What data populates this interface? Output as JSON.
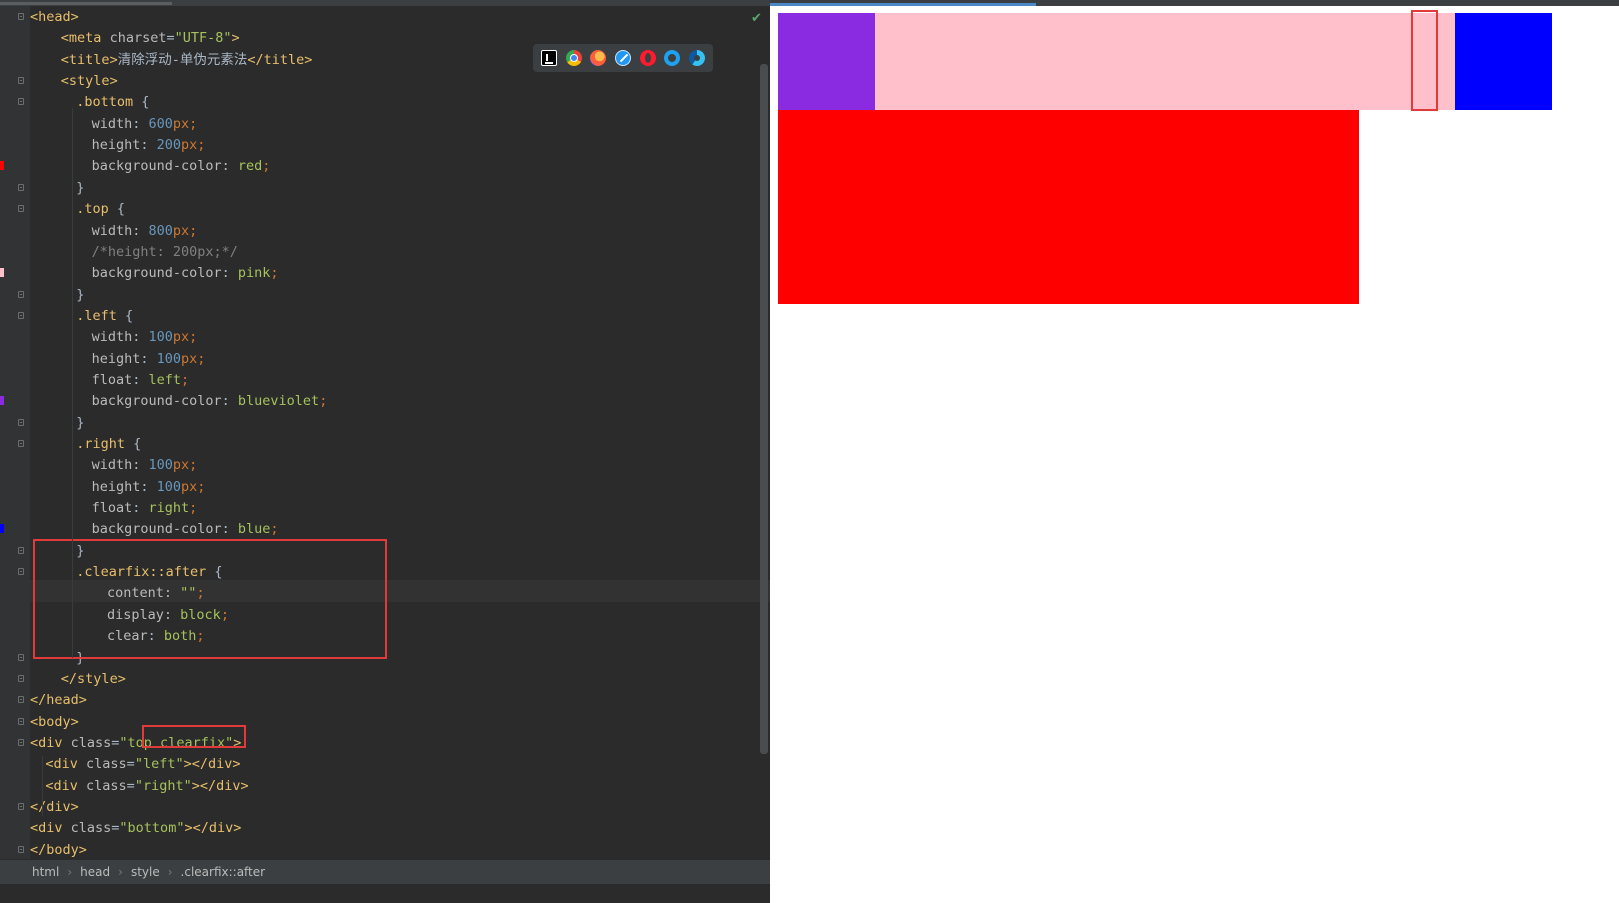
{
  "editor": {
    "lines": [
      {
        "indent": 0,
        "parts": [
          [
            "tag",
            "<head>"
          ]
        ]
      },
      {
        "indent": 4,
        "parts": [
          [
            "tag",
            "<meta "
          ],
          [
            "attr",
            "charset"
          ],
          [
            "txt",
            "="
          ],
          [
            "str",
            "\"UTF-8\""
          ],
          [
            "tag",
            ">"
          ]
        ]
      },
      {
        "indent": 4,
        "parts": [
          [
            "tag",
            "<title>"
          ],
          [
            "txt",
            "清除浮动-单伪元素法"
          ],
          [
            "tag",
            "</title>"
          ]
        ]
      },
      {
        "indent": 4,
        "parts": [
          [
            "tag",
            "<style>"
          ]
        ]
      },
      {
        "indent": 6,
        "parts": [
          [
            "sel",
            ".bottom"
          ],
          [
            "txt",
            " {"
          ]
        ]
      },
      {
        "indent": 8,
        "parts": [
          [
            "prop",
            "width"
          ],
          [
            "txt",
            ": "
          ],
          [
            "num",
            "600"
          ],
          [
            "unit",
            "px"
          ],
          [
            "punc",
            ";"
          ]
        ]
      },
      {
        "indent": 8,
        "parts": [
          [
            "prop",
            "height"
          ],
          [
            "txt",
            ": "
          ],
          [
            "num",
            "200"
          ],
          [
            "unit",
            "px"
          ],
          [
            "punc",
            ";"
          ]
        ]
      },
      {
        "indent": 8,
        "parts": [
          [
            "prop",
            "background-color"
          ],
          [
            "txt",
            ": "
          ],
          [
            "kw",
            "red"
          ],
          [
            "punc",
            ";"
          ]
        ]
      },
      {
        "indent": 6,
        "parts": [
          [
            "txt",
            "}"
          ]
        ]
      },
      {
        "indent": 6,
        "parts": [
          [
            "sel",
            ".top"
          ],
          [
            "txt",
            " {"
          ]
        ]
      },
      {
        "indent": 8,
        "parts": [
          [
            "prop",
            "width"
          ],
          [
            "txt",
            ": "
          ],
          [
            "num",
            "800"
          ],
          [
            "unit",
            "px"
          ],
          [
            "punc",
            ";"
          ]
        ]
      },
      {
        "indent": 8,
        "parts": [
          [
            "cmt",
            "/*height: 200px;*/"
          ]
        ]
      },
      {
        "indent": 8,
        "parts": [
          [
            "prop",
            "background-color"
          ],
          [
            "txt",
            ": "
          ],
          [
            "kw",
            "pink"
          ],
          [
            "punc",
            ";"
          ]
        ]
      },
      {
        "indent": 6,
        "parts": [
          [
            "txt",
            "}"
          ]
        ]
      },
      {
        "indent": 6,
        "parts": [
          [
            "sel",
            ".left"
          ],
          [
            "txt",
            " {"
          ]
        ]
      },
      {
        "indent": 8,
        "parts": [
          [
            "prop",
            "width"
          ],
          [
            "txt",
            ": "
          ],
          [
            "num",
            "100"
          ],
          [
            "unit",
            "px"
          ],
          [
            "punc",
            ";"
          ]
        ]
      },
      {
        "indent": 8,
        "parts": [
          [
            "prop",
            "height"
          ],
          [
            "txt",
            ": "
          ],
          [
            "num",
            "100"
          ],
          [
            "unit",
            "px"
          ],
          [
            "punc",
            ";"
          ]
        ]
      },
      {
        "indent": 8,
        "parts": [
          [
            "prop",
            "float"
          ],
          [
            "txt",
            ": "
          ],
          [
            "kw",
            "left"
          ],
          [
            "punc",
            ";"
          ]
        ]
      },
      {
        "indent": 8,
        "parts": [
          [
            "prop",
            "background-color"
          ],
          [
            "txt",
            ": "
          ],
          [
            "kw",
            "blueviolet"
          ],
          [
            "punc",
            ";"
          ]
        ]
      },
      {
        "indent": 6,
        "parts": [
          [
            "txt",
            "}"
          ]
        ]
      },
      {
        "indent": 6,
        "parts": [
          [
            "sel",
            ".right"
          ],
          [
            "txt",
            " {"
          ]
        ]
      },
      {
        "indent": 8,
        "parts": [
          [
            "prop",
            "width"
          ],
          [
            "txt",
            ": "
          ],
          [
            "num",
            "100"
          ],
          [
            "unit",
            "px"
          ],
          [
            "punc",
            ";"
          ]
        ]
      },
      {
        "indent": 8,
        "parts": [
          [
            "prop",
            "height"
          ],
          [
            "txt",
            ": "
          ],
          [
            "num",
            "100"
          ],
          [
            "unit",
            "px"
          ],
          [
            "punc",
            ";"
          ]
        ]
      },
      {
        "indent": 8,
        "parts": [
          [
            "prop",
            "float"
          ],
          [
            "txt",
            ": "
          ],
          [
            "kw",
            "right"
          ],
          [
            "punc",
            ";"
          ]
        ]
      },
      {
        "indent": 8,
        "parts": [
          [
            "prop",
            "background-color"
          ],
          [
            "txt",
            ": "
          ],
          [
            "kw",
            "blue"
          ],
          [
            "punc",
            ";"
          ]
        ]
      },
      {
        "indent": 6,
        "parts": [
          [
            "txt",
            "}"
          ]
        ]
      },
      {
        "indent": 6,
        "parts": [
          [
            "sel",
            ".clearfix::after"
          ],
          [
            "txt",
            " {"
          ]
        ]
      },
      {
        "indent": 10,
        "parts": [
          [
            "prop",
            "content"
          ],
          [
            "txt",
            ": "
          ],
          [
            "str",
            "\"\""
          ],
          [
            "punc",
            ";"
          ]
        ]
      },
      {
        "indent": 10,
        "parts": [
          [
            "prop",
            "display"
          ],
          [
            "txt",
            ": "
          ],
          [
            "kw",
            "block"
          ],
          [
            "punc",
            ";"
          ]
        ]
      },
      {
        "indent": 10,
        "parts": [
          [
            "prop",
            "clear"
          ],
          [
            "txt",
            ": "
          ],
          [
            "kw",
            "both"
          ],
          [
            "punc",
            ";"
          ]
        ]
      },
      {
        "indent": 6,
        "parts": [
          [
            "txt",
            "}"
          ]
        ]
      },
      {
        "indent": 4,
        "parts": [
          [
            "tag",
            "</style>"
          ]
        ]
      },
      {
        "indent": 0,
        "parts": [
          [
            "tag",
            "</head>"
          ]
        ]
      },
      {
        "indent": 0,
        "parts": [
          [
            "tag",
            "<body>"
          ]
        ]
      },
      {
        "indent": 0,
        "parts": [
          [
            "tag",
            "<div "
          ],
          [
            "attr",
            "class"
          ],
          [
            "txt",
            "="
          ],
          [
            "str",
            "\"top clearfix\""
          ],
          [
            "tag",
            ">"
          ]
        ]
      },
      {
        "indent": 2,
        "parts": [
          [
            "tag",
            "<div "
          ],
          [
            "attr",
            "class"
          ],
          [
            "txt",
            "="
          ],
          [
            "str",
            "\"left\""
          ],
          [
            "tag",
            "></div>"
          ]
        ]
      },
      {
        "indent": 2,
        "parts": [
          [
            "tag",
            "<div "
          ],
          [
            "attr",
            "class"
          ],
          [
            "txt",
            "="
          ],
          [
            "str",
            "\"right\""
          ],
          [
            "tag",
            "></div>"
          ]
        ]
      },
      {
        "indent": 0,
        "parts": [
          [
            "tag",
            "</div>"
          ]
        ]
      },
      {
        "indent": 0,
        "parts": [
          [
            "tag",
            "<div "
          ],
          [
            "attr",
            "class"
          ],
          [
            "txt",
            "="
          ],
          [
            "str",
            "\"bottom\""
          ],
          [
            "tag",
            "></div>"
          ]
        ]
      },
      {
        "indent": 0,
        "parts": [
          [
            "tag",
            "</body>"
          ]
        ]
      }
    ]
  },
  "browser_icons": [
    "intellij-icon",
    "chrome-icon",
    "firefox-icon",
    "safari-icon",
    "opera-icon",
    "ie-icon",
    "edge-icon"
  ],
  "breadcrumb": [
    "html",
    "head",
    "style",
    ".clearfix::after"
  ],
  "preview": {
    "colors": {
      "top": "#ffc0cb",
      "left": "#8a2be2",
      "right": "#0000ff",
      "bottom": "#ff0000"
    }
  },
  "highlight_color": "#e03a3a"
}
